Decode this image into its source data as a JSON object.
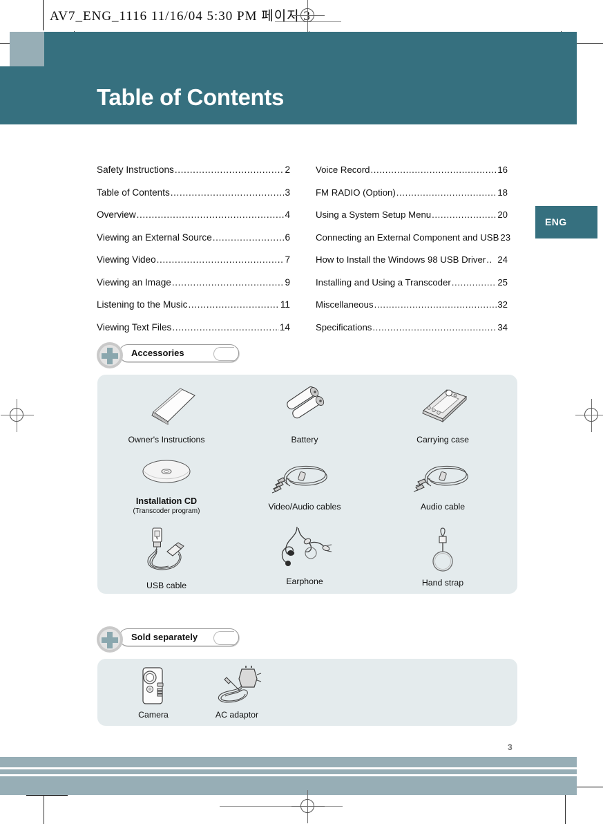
{
  "print_header": {
    "text": "AV7_ENG_1116  11/16/04  5:30 PM  페이지 3"
  },
  "header": {
    "tab_label": "Table of Contents",
    "title": "Table of Contents",
    "language_tab": "ENG"
  },
  "toc": {
    "left": [
      {
        "title": "Safety Instructions",
        "leader": "............................................",
        "page": "2"
      },
      {
        "title": "Table of Contents ",
        "leader": "..........................................",
        "page": "3"
      },
      {
        "title": "Overview ",
        "leader": "......................................................",
        "page": "4"
      },
      {
        "title": "Viewing an External Source ",
        "leader": "...........................",
        "page": "6"
      },
      {
        "title": "Viewing Video",
        "leader": "................................................",
        "page": "7"
      },
      {
        "title": "Viewing an Image ",
        "leader": "..........................................",
        "page": "9"
      },
      {
        "title": "Listening to the Music ",
        "leader": "...................................",
        "page": "11"
      },
      {
        "title": "Viewing Text Files",
        "leader": "..........................................",
        "page": "14"
      }
    ],
    "right": [
      {
        "title": "Voice Record",
        "leader": "................................................",
        "page": "16"
      },
      {
        "title": "FM RADIO (Option)",
        "leader": ".......................................",
        "page": "18"
      },
      {
        "title": "Using a System Setup Menu ",
        "leader": ".......................",
        "page": "20"
      },
      {
        "title": "Connecting an External Component and USB ",
        "leader": "...",
        "page": "23"
      },
      {
        "title": "How to Install the Windows 98 USB Driver",
        "leader": "..",
        "page": "24"
      },
      {
        "title": "Installing and Using a Transcoder ",
        "leader": "................",
        "page": "25"
      },
      {
        "title": "Miscellaneous ",
        "leader": "..............................................",
        "page": "32"
      },
      {
        "title": "Specifications ",
        "leader": "..............................................",
        "page": "34"
      }
    ]
  },
  "accessories": {
    "badge_label": "Accessories",
    "items": [
      {
        "name": "Owner's Instructions",
        "sub": "",
        "icon": "manual-icon"
      },
      {
        "name": "Battery",
        "sub": "",
        "icon": "battery-icon"
      },
      {
        "name": "Carrying case",
        "sub": "",
        "icon": "carrying-case-icon"
      },
      {
        "name": "Installation CD",
        "sub": "(Transcoder program)",
        "icon": "cd-disc-icon"
      },
      {
        "name": "Video/Audio cables",
        "sub": "",
        "icon": "av-cable-icon"
      },
      {
        "name": "Audio cable",
        "sub": "",
        "icon": "audio-cable-icon"
      },
      {
        "name": "USB cable",
        "sub": "",
        "icon": "usb-cable-icon"
      },
      {
        "name": "Earphone",
        "sub": "",
        "icon": "earphone-icon"
      },
      {
        "name": "Hand strap",
        "sub": "",
        "icon": "hand-strap-icon"
      }
    ]
  },
  "sold_separately": {
    "badge_label": "Sold separately",
    "items": [
      {
        "name": "Camera",
        "sub": "",
        "icon": "camera-icon"
      },
      {
        "name": "AC adaptor",
        "sub": "",
        "icon": "ac-adaptor-icon"
      }
    ]
  },
  "footer": {
    "page_number": "3"
  },
  "colors": {
    "teal": "#36707f",
    "light_blue_gray": "#97aeb6",
    "panel": "#e4ebed",
    "plus_icon": "#8aa7ae"
  }
}
